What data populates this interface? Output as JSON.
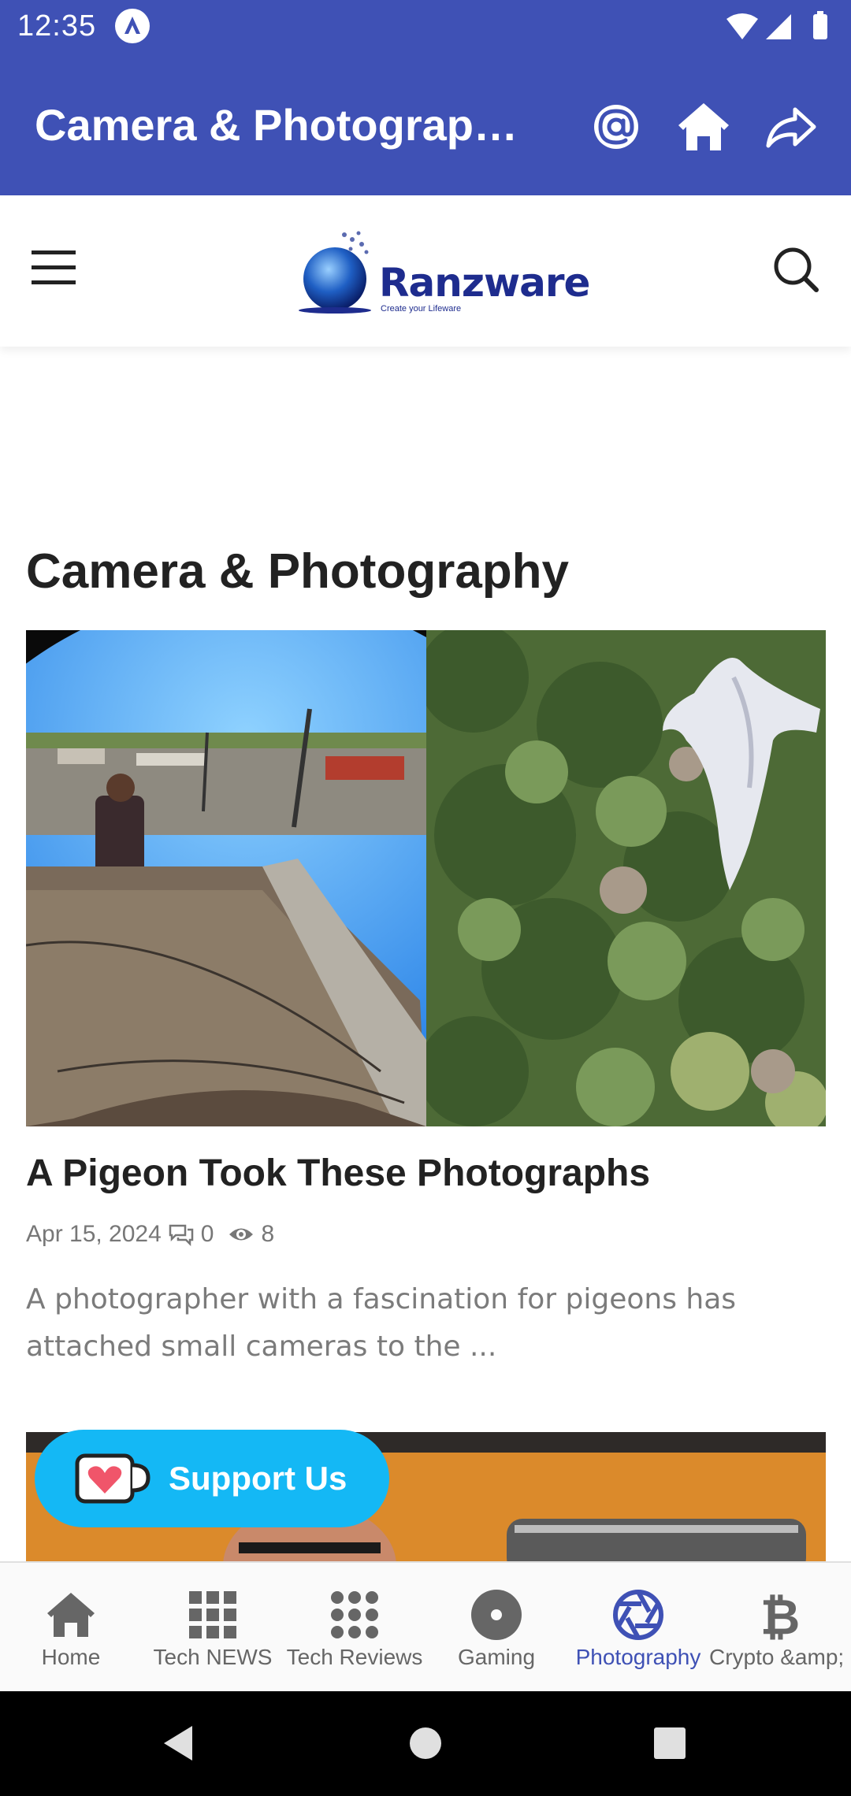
{
  "status_bar": {
    "time": "12:35"
  },
  "app_bar": {
    "title": "Camera & Photography..."
  },
  "site": {
    "logo_text": "Ranzware",
    "logo_tagline": "Create your Lifeware"
  },
  "page": {
    "heading": "Camera & Photography"
  },
  "article": {
    "title": "A Pigeon Took These Photographs",
    "date": "Apr 15, 2024",
    "comments": "0",
    "views": "8",
    "excerpt": "A photographer with a fascination for pigeons has attached small cameras to the ..."
  },
  "support": {
    "label": "Support Us"
  },
  "bottom_nav": {
    "items": [
      {
        "label": "Home",
        "icon": "home-icon"
      },
      {
        "label": "Tech NEWS",
        "icon": "grid-icon"
      },
      {
        "label": "Tech Reviews",
        "icon": "dots-grid-icon"
      },
      {
        "label": "Gaming",
        "icon": "disc-icon"
      },
      {
        "label": "Photography",
        "icon": "aperture-icon"
      },
      {
        "label": "Crypto &amp; Bitc",
        "icon": "bitcoin-icon"
      }
    ],
    "active_index": 4
  },
  "colors": {
    "primary": "#3f51b5",
    "support": "#14b8f5"
  }
}
